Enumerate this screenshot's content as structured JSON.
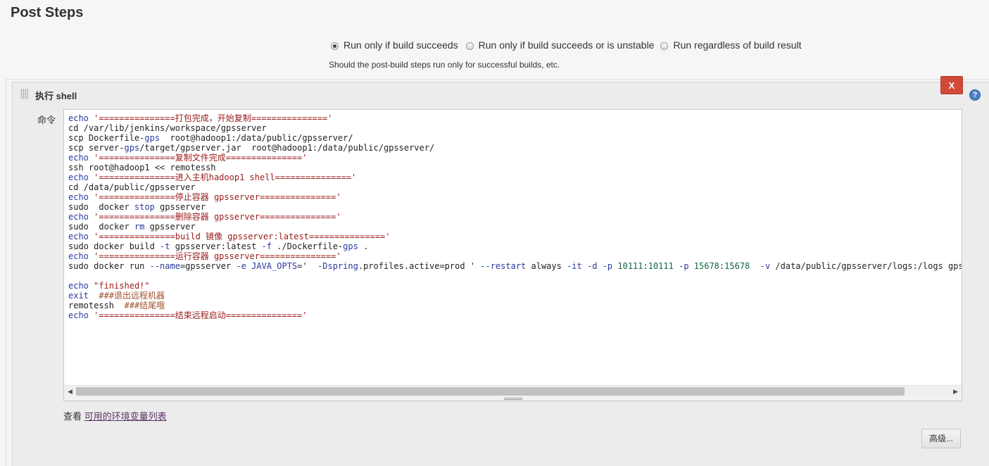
{
  "section": {
    "title": "Post Steps"
  },
  "run_condition": {
    "options": [
      {
        "label": "Run only if build succeeds",
        "checked": true
      },
      {
        "label": "Run only if build succeeds or is unstable",
        "checked": false
      },
      {
        "label": "Run regardless of build result",
        "checked": false
      }
    ],
    "hint": "Should the post-build steps run only for successful builds, etc."
  },
  "build_step": {
    "title": "执行 shell",
    "delete_label": "X",
    "help_icon": "?",
    "command_label": "命令",
    "command_lines": [
      "echo '===============打包完成，开始复制==============='",
      "cd /var/lib/jenkins/workspace/gpsserver",
      "scp Dockerfile-gps  root@hadoop1:/data/public/gpsserver/",
      "scp server-gps/target/gpserver.jar  root@hadoop1:/data/public/gpsserver/",
      "echo '===============复制文件完成==============='",
      "ssh root@hadoop1 << remotessh",
      "echo '===============进入主机hadoop1 shell==============='",
      "cd /data/public/gpsserver",
      "echo '===============停止容器 gpsserver==============='",
      "sudo  docker stop gpsserver",
      "echo '===============删除容器 gpsserver==============='",
      "sudo  docker rm gpsserver",
      "echo '===============build 镜像 gpsserver:latest==============='",
      "sudo docker build -t gpsserver:latest -f ./Dockerfile-gps .",
      "echo '===============运行容器 gpsserver==============='",
      "sudo docker run --name=gpsserver -e JAVA_OPTS='  -Dspring.profiles.active=prod ' --restart always -it -d -p 10111:10111 -p 15678:15678  -v /data/public/gpsserver/logs:/logs gpsserver:latest",
      "",
      "echo \"finished!\"",
      "exit  ###退出远程机器",
      "remotessh  ###结尾哦",
      "echo '===============结束远程启动==============='"
    ]
  },
  "env_link": {
    "prefix": "查看",
    "link_text": "可用的环境变量列表"
  },
  "advanced_button": {
    "label": "高级..."
  }
}
